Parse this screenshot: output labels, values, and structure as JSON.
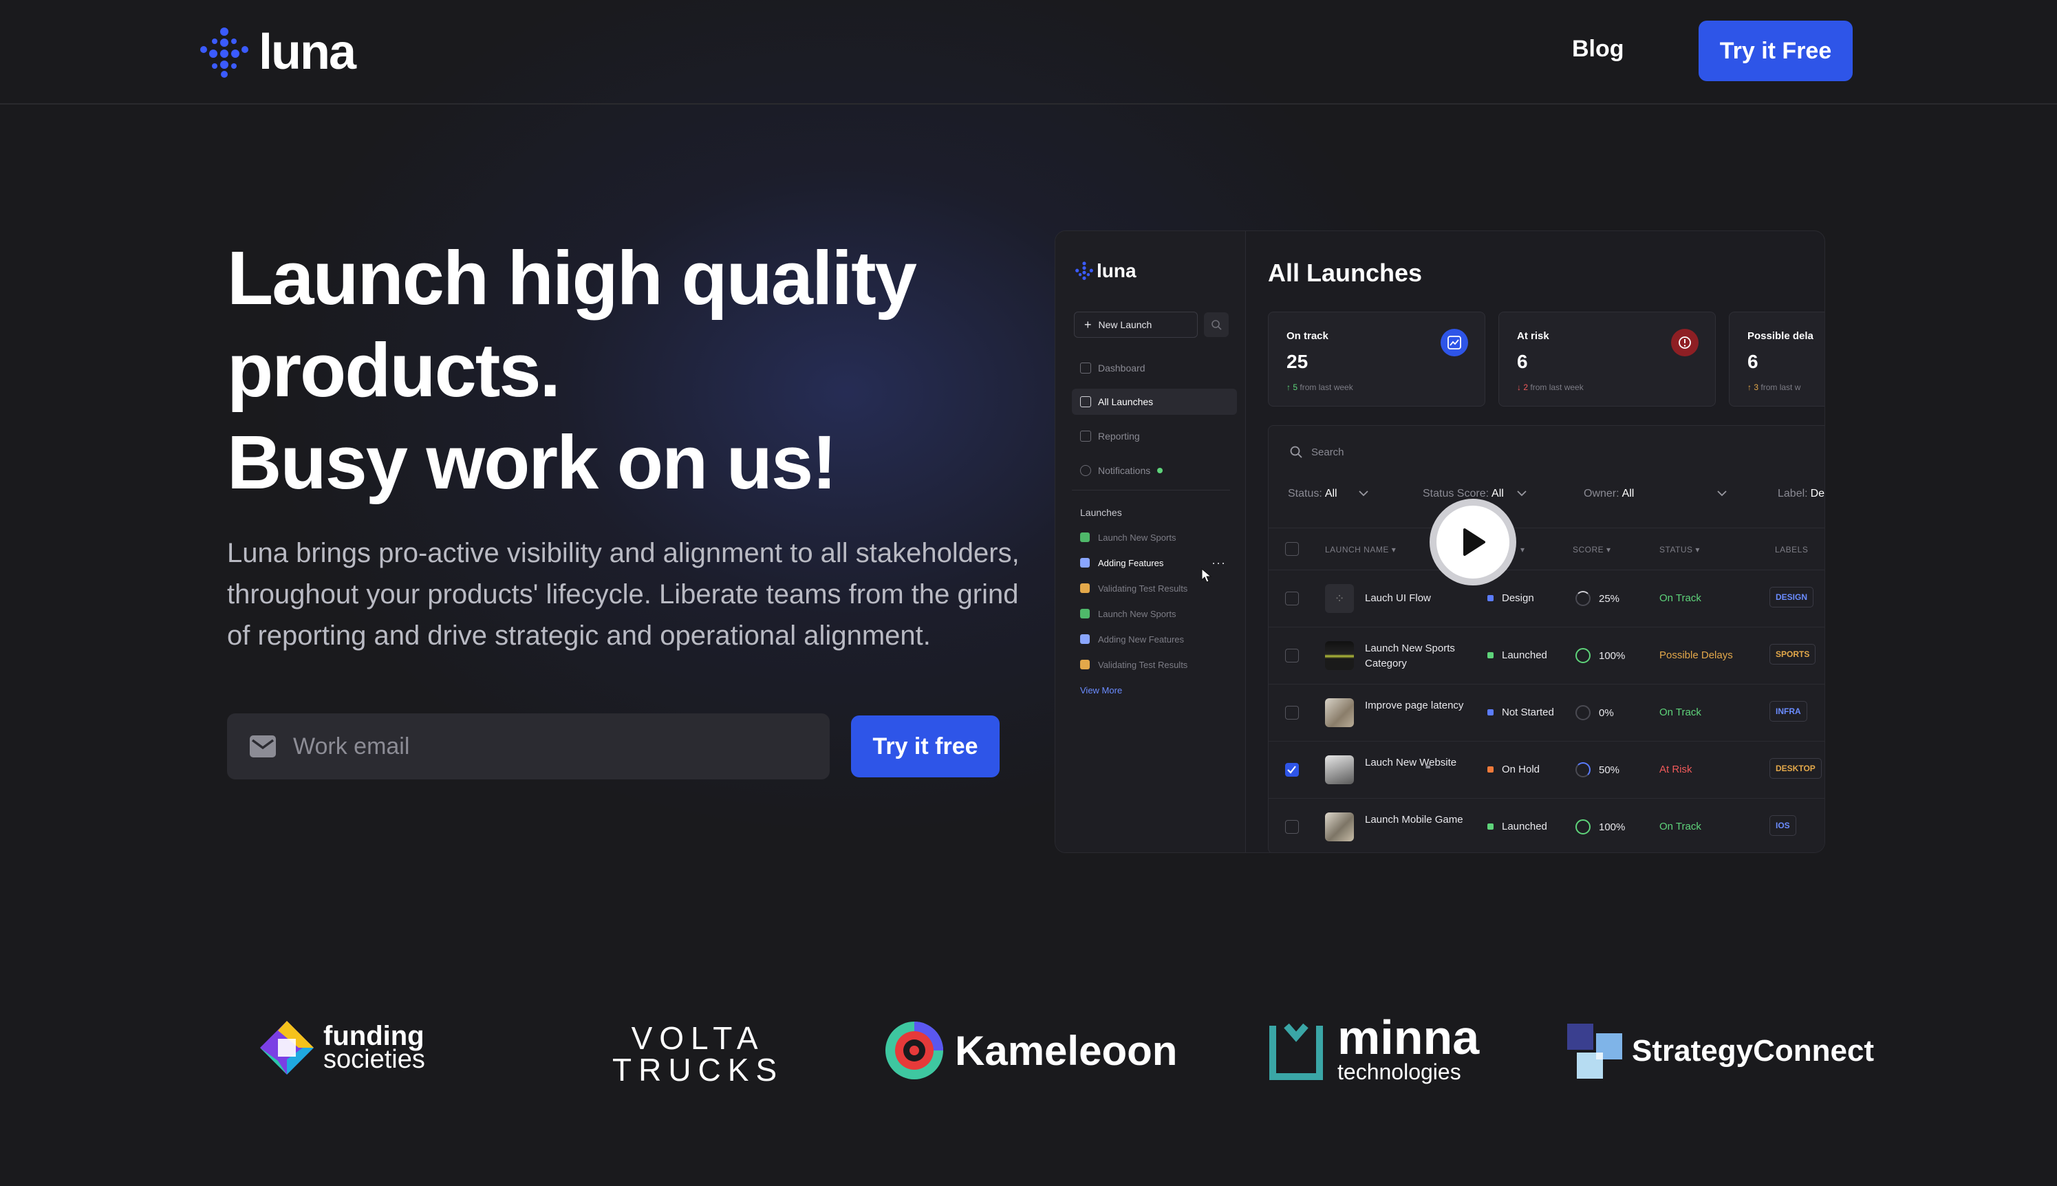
{
  "nav": {
    "brand": "luna",
    "blog": "Blog",
    "cta": "Try it Free"
  },
  "hero": {
    "title_line1": "Launch high quality",
    "title_line2": "products.",
    "title_line3": "Busy work on us!",
    "subtitle": "Luna brings pro-active visibility and alignment to all stakeholders, throughout your products' lifecycle. Liberate teams from the grind of reporting and drive strategic and operational alignment.",
    "email_placeholder": "Work email",
    "cta": "Try it free"
  },
  "app": {
    "brand": "luna",
    "new_launch": "New Launch",
    "menu": [
      {
        "label": "Dashboard",
        "icon": "grid-icon"
      },
      {
        "label": "All Launches",
        "icon": "document-icon"
      },
      {
        "label": "Reporting",
        "icon": "bar-chart-icon"
      },
      {
        "label": "Notifications",
        "icon": "bell-icon"
      }
    ],
    "launches_heading": "Launches",
    "launches": [
      {
        "label": "Launch New Sports",
        "color": "#4fb86a"
      },
      {
        "label": "Adding  Features",
        "color": "#8aa6ff"
      },
      {
        "label": "Validating Test Results",
        "color": "#e3a84a"
      },
      {
        "label": "Launch New Sports",
        "color": "#4fb86a"
      },
      {
        "label": "Adding New Features",
        "color": "#8aa6ff"
      },
      {
        "label": "Validating Test Results",
        "color": "#e3a84a"
      }
    ],
    "view_more": "View More",
    "title": "All Launches",
    "cards": [
      {
        "label": "On track",
        "value": "25",
        "arrow": "↑",
        "delta": "5",
        "note": "from last week",
        "delta_color": "#5ed37a"
      },
      {
        "label": "At risk",
        "value": "6",
        "arrow": "↓",
        "delta": "2",
        "note": "from last week",
        "delta_color": "#ef5a5a"
      },
      {
        "label": "Possible dela",
        "value": "6",
        "arrow": "↑",
        "delta": "3",
        "note": "from last w",
        "delta_color": "#e3a84a"
      }
    ],
    "search_placeholder": "Search",
    "filters": [
      {
        "label": "Status:",
        "value": "All"
      },
      {
        "label": "Status Score:",
        "value": "All"
      },
      {
        "label": "Owner:",
        "value": "All"
      },
      {
        "label": "Label:",
        "value": "De"
      }
    ],
    "columns": [
      "LAUNCH NAME",
      "SCORE",
      "STATUS",
      "LABELS"
    ],
    "rows": [
      {
        "name": "Lauch UI Flow",
        "stage": "Design",
        "stage_color": "#5b7cff",
        "score": "25%",
        "score_value": 25,
        "status": "On Track",
        "status_color": "#5ed37a",
        "label": "DESIGN",
        "label_color": "#6b8cff",
        "checked": false
      },
      {
        "name": "Launch New Sports Category",
        "stage": "Launched",
        "stage_color": "#5ed37a",
        "score": "100%",
        "score_value": 100,
        "status": "Possible Delays",
        "status_color": "#e3a84a",
        "label": "SPORTS",
        "label_color": "#e3a84a",
        "checked": false
      },
      {
        "name": "Improve page latency",
        "stage": "Not Started",
        "stage_color": "#5b7cff",
        "score": "0%",
        "score_value": 0,
        "status": "On Track",
        "status_color": "#5ed37a",
        "label": "INFRA",
        "label_color": "#6b8cff",
        "checked": false
      },
      {
        "name": "Lauch New Website",
        "stage": "On Hold",
        "stage_color": "#f07a3a",
        "score": "50%",
        "score_value": 50,
        "status": "At Risk",
        "status_color": "#ef5a5a",
        "label": "DESKTOP",
        "label_color": "#e3a84a",
        "checked": true
      },
      {
        "name": "Launch Mobile Game",
        "stage": "Launched",
        "stage_color": "#5ed37a",
        "score": "100%",
        "score_value": 100,
        "status": "On Track",
        "status_color": "#5ed37a",
        "label": "IOS",
        "label_color": "#6b8cff",
        "checked": false
      }
    ]
  },
  "logos": [
    {
      "name": "funding",
      "sub": "societies"
    },
    {
      "name": "VOLTA",
      "sub": "TRUCKS"
    },
    {
      "name": "Kameleoon"
    },
    {
      "name": "minna",
      "sub": "technologies"
    },
    {
      "name": "StrategyConnect"
    }
  ],
  "colors": {
    "accent": "#2e55e8",
    "background": "#1a1a1d"
  }
}
